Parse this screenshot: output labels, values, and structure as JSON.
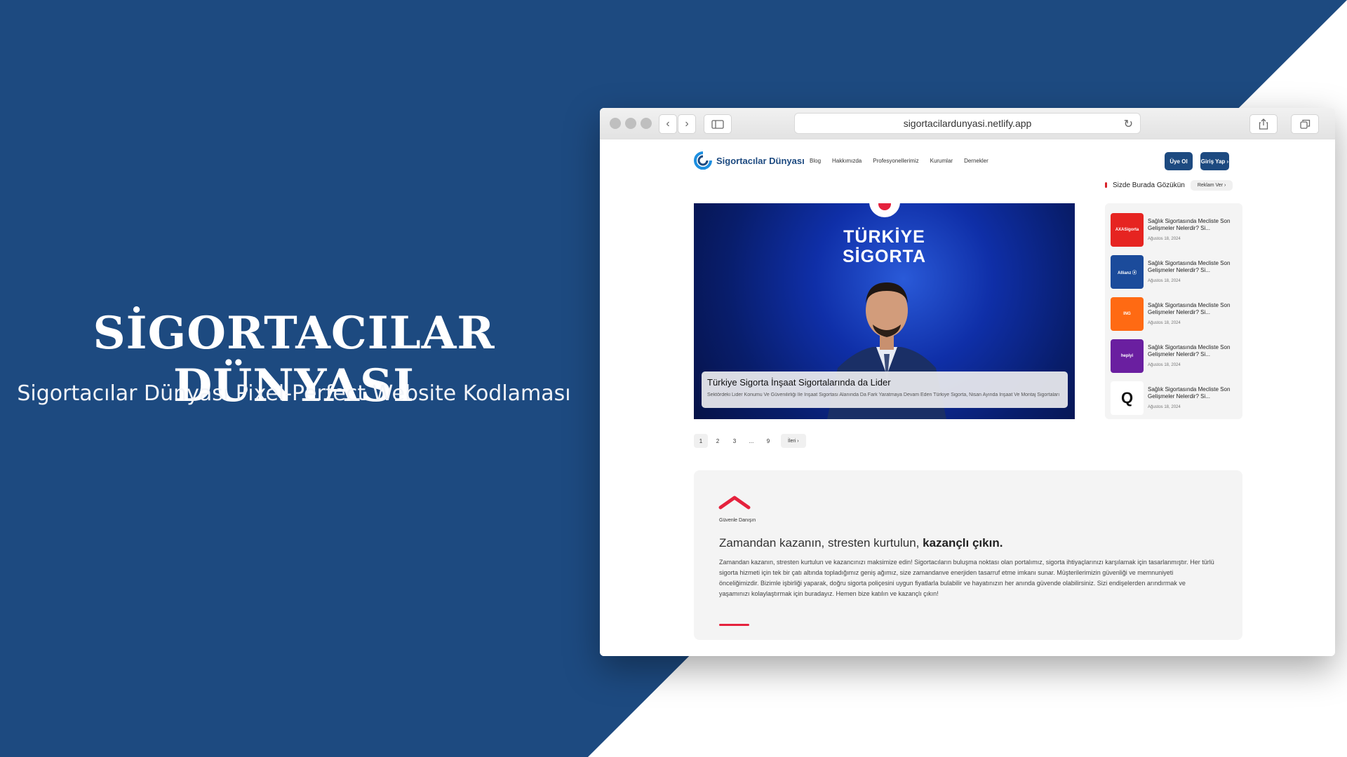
{
  "hero": {
    "title": "SİGORTACILAR DÜNYASI",
    "subtitle": "Sigortacılar Dünyası Pixel-Perfect Website Kodlaması"
  },
  "browser": {
    "url": "sigortacilardunyasi.netlify.app"
  },
  "site": {
    "logo_text": "Sigortacılar Dünyası",
    "menu": [
      "Blog",
      "Hakkımızda",
      "Profesyonellerimiz",
      "Kurumlar",
      "Dernekler"
    ],
    "signup_label": "Üye Ol",
    "login_label": "Giriş Yap ›"
  },
  "ad_bar": {
    "text": "Sizde Burada Gözükün",
    "button": "Reklam Ver ›"
  },
  "feature": {
    "brand_line1": "TÜRKİYE",
    "brand_line2": "SİGORTA",
    "title": "Türkiye Sigorta İnşaat Sigortalarında da Lider",
    "excerpt": "Sektördeki Lider Konumu Ve Güvenilirliği İle İnşaat Sigortası Alanında Da Fark Yaratmaya Devam Eden Türkiye Sigorta, Nisan Ayında İnşaat Ve Montaj Sigortaları"
  },
  "pagination": {
    "pages": [
      "1",
      "2",
      "3",
      "...",
      "9"
    ],
    "next": "İleri ›"
  },
  "news": [
    {
      "thumb_label": "AXASigorta",
      "thumb_color": "#e62421",
      "title": "Sağlık Sigortasında Mecliste Son Gelişmeler Nelerdir? Si...",
      "date": "Ağustos 18, 2024"
    },
    {
      "thumb_label": "Allianz ⓐ",
      "thumb_color": "#1b4b9b",
      "title": "Sağlık Sigortasında Mecliste Son Gelişmeler Nelerdir? Si...",
      "date": "Ağustos 18, 2024"
    },
    {
      "thumb_label": "ING",
      "thumb_color": "#ff6a13",
      "title": "Sağlık Sigortasında Mecliste Son Gelişmeler Nelerdir? Si...",
      "date": "Ağustos 18, 2024"
    },
    {
      "thumb_label": "hepiyi",
      "thumb_color": "#6a1fa0",
      "title": "Sağlık Sigortasında Mecliste Son Gelişmeler Nelerdir? Si...",
      "date": "Ağustos 18, 2024"
    },
    {
      "thumb_label": "Q",
      "thumb_color": "#ffffff",
      "title": "Sağlık Sigortasında Mecliste Son Gelişmeler Nelerdir? Si...",
      "date": "Ağustos 18, 2024"
    }
  ],
  "info": {
    "small_label": "Güvenle Danışın",
    "heading_plain": "Zamandan kazanın, stresten kurtulun, ",
    "heading_bold": "kazançlı çıkın.",
    "body": "Zamandan kazanın, stresten kurtulun ve kazancınızı maksimize edin! Sigortacıların buluşma noktası olan portalımız, sigorta ihtiyaçlarınızı karşılamak için tasarlanmıştır. Her türlü sigorta hizmeti için tek bir çatı altında topladığımız geniş ağımız, size zamandanve enerjiden tasarruf etme imkanı sunar. Müşterilerimizin güvenliği ve memnuniyeti önceliğimizdir. Bizimle işbirliği yaparak, doğru sigorta poliçesini uygun fiyatlarla bulabilir ve hayatınızın her anında güvende olabilirsiniz. Sizi endişelerden arındırmak ve yaşamınızı kolaylaştırmak için buradayız. Hemen bize katılın ve kazançlı çıkın!"
  },
  "colors": {
    "brand_blue": "#1d4a80",
    "accent_red": "#e5223d"
  }
}
